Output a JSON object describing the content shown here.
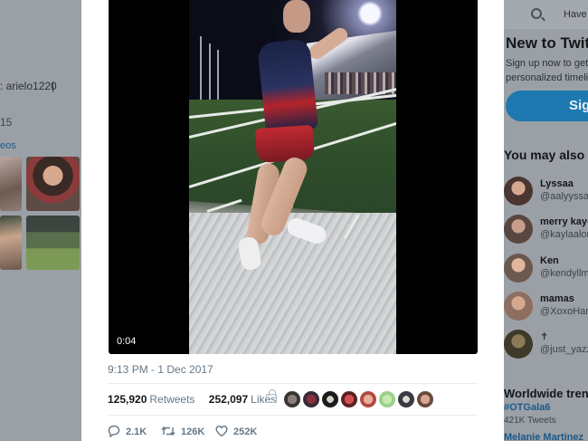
{
  "background_left": {
    "handle_fragment": ": arielo1220",
    "handle_bar": "|",
    "count_fragment": "15",
    "videos_fragment": "eos"
  },
  "background_right": {
    "have_account": "Have a",
    "new_title": "New to Twitte",
    "signup_line1": "Sign up now to get y",
    "signup_line2": "personalized timeline",
    "signup_button": "Sig",
    "may_like_title": "You may also li",
    "suggestions": [
      {
        "name": "Lyssaa",
        "handle": "@aalyyssaa"
      },
      {
        "name": "merry kay-",
        "handle": "@kaylaalon"
      },
      {
        "name": "Ken",
        "handle": "@kendyllmo"
      },
      {
        "name": "mamas",
        "handle": "@XoxoHan"
      },
      {
        "name": "",
        "handle": "@just_yazz"
      }
    ],
    "worldwide_title": "Worldwide tren",
    "trend1": "#OTGala6",
    "trend1_count": "421K Tweets",
    "trend2": "Melanie Martinez"
  },
  "tweet": {
    "video_time": "0:04",
    "timestamp": "9:13 PM - 1 Dec 2017",
    "retweets_count": "125,920",
    "retweets_label": "Retweets",
    "likes_count": "252,097",
    "likes_label": "Likes",
    "reply_count": "2.1K",
    "retweet_action_count": "126K",
    "like_action_count": "252K"
  },
  "colors": {
    "accent": "#1da1f2",
    "meta_text": "#657786",
    "overlay": "#8a9097"
  }
}
